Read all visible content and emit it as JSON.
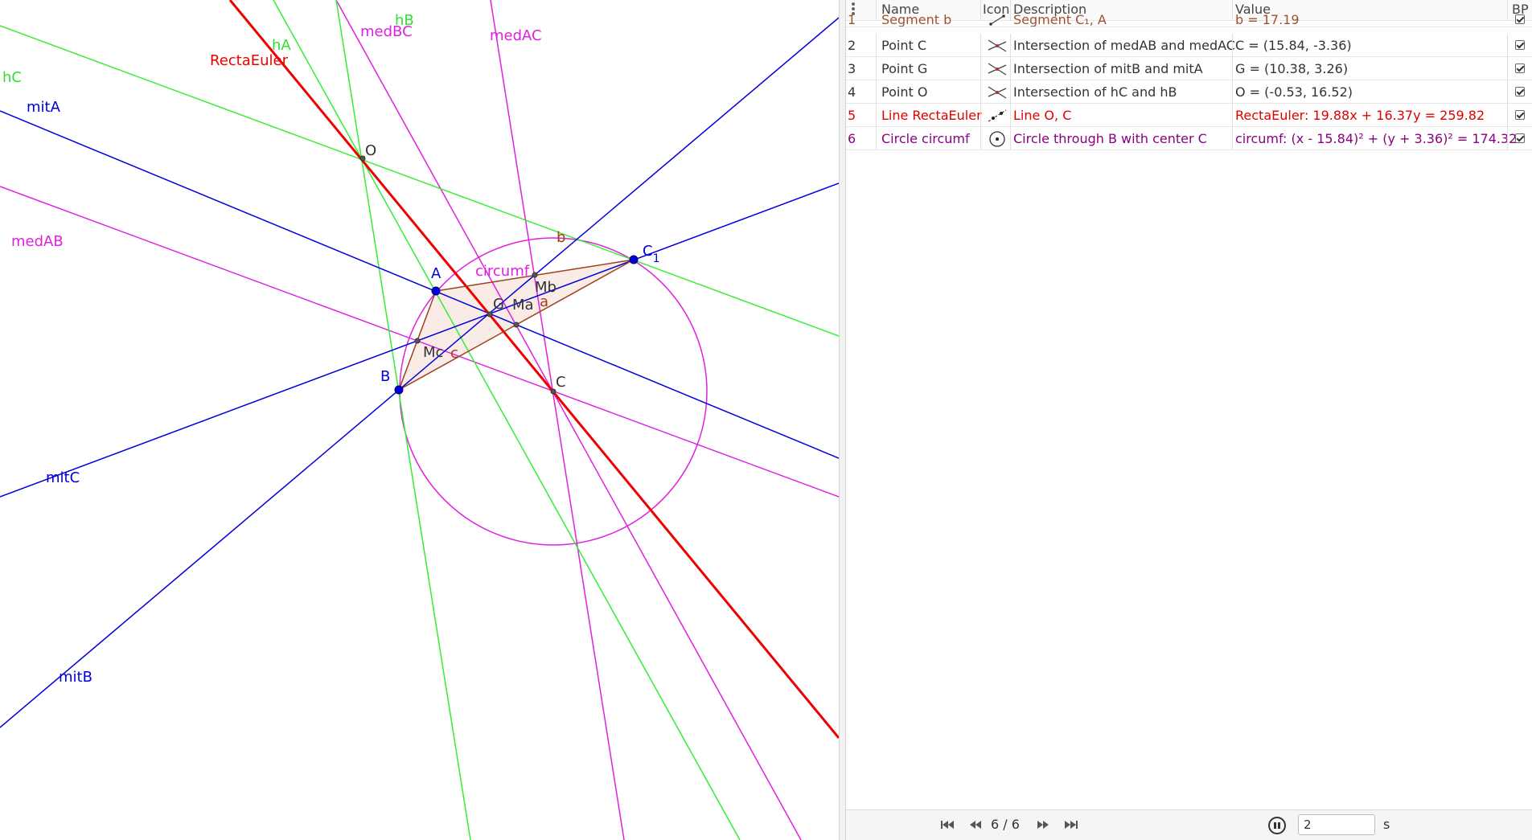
{
  "graphics": {
    "labels": {
      "hC": "hC",
      "mitA": "mitA",
      "RectaEuler": "RectaEuler",
      "hA": "hA",
      "medBC": "medBC",
      "hB": "hB",
      "medAC": "medAC",
      "O": "O",
      "medAB": "medAB",
      "A": "A",
      "circumf": "circumf",
      "b": "b",
      "C1_main": "C",
      "C1_sub": "1",
      "Mb": "Mb",
      "G": "G",
      "Ma": "Ma",
      "a": "a",
      "Mc": "Mc",
      "c": "c",
      "B": "B",
      "C": "C",
      "mitC": "mitC",
      "mitB": "mitB"
    }
  },
  "protocol": {
    "menu_icon": "three-dots-vertical-icon",
    "headers": {
      "name": "Name",
      "icon": "Icon",
      "description": "Description",
      "value": "Value",
      "bp": "BP"
    },
    "rows": [
      {
        "num": "1",
        "name": "Segment b",
        "icon": "segment-icon",
        "description": "Segment C₁, A",
        "value": "b = 17.19",
        "color": "#a0522d",
        "bp": true
      },
      {
        "num": "2",
        "name": "Point C",
        "icon": "intersect-icon",
        "description": "Intersection of medAB and medAC",
        "value": "C = (15.84, -3.36)",
        "color": "#333333",
        "bp": true
      },
      {
        "num": "3",
        "name": "Point G",
        "icon": "intersect-icon",
        "description": "Intersection of mitB and mitA",
        "value": "G = (10.38, 3.26)",
        "color": "#333333",
        "bp": true
      },
      {
        "num": "4",
        "name": "Point O",
        "icon": "intersect-icon",
        "description": "Intersection of hC and hB",
        "value": "O = (-0.53, 16.52)",
        "color": "#333333",
        "bp": true
      },
      {
        "num": "5",
        "name": "Line RectaEuler",
        "icon": "line-icon",
        "description": "Line O, C",
        "value": "RectaEuler: 19.88x + 16.37y = 259.82",
        "color": "#e00000",
        "bp": true
      },
      {
        "num": "6",
        "name": "Circle circumf",
        "icon": "circle-center-icon",
        "description": "Circle through B with center C",
        "value": "circumf: (x - 15.84)² + (y + 3.36)² = 174.32",
        "color": "#8b0080",
        "bp": true
      }
    ],
    "navigation": {
      "step": "6 / 6",
      "delay_value": "2",
      "delay_unit": "s",
      "first_icon": "skip-first-icon",
      "prev_icon": "skip-previous-icon",
      "next_icon": "skip-next-icon",
      "last_icon": "skip-last-icon",
      "play_icon": "pause-icon"
    }
  }
}
